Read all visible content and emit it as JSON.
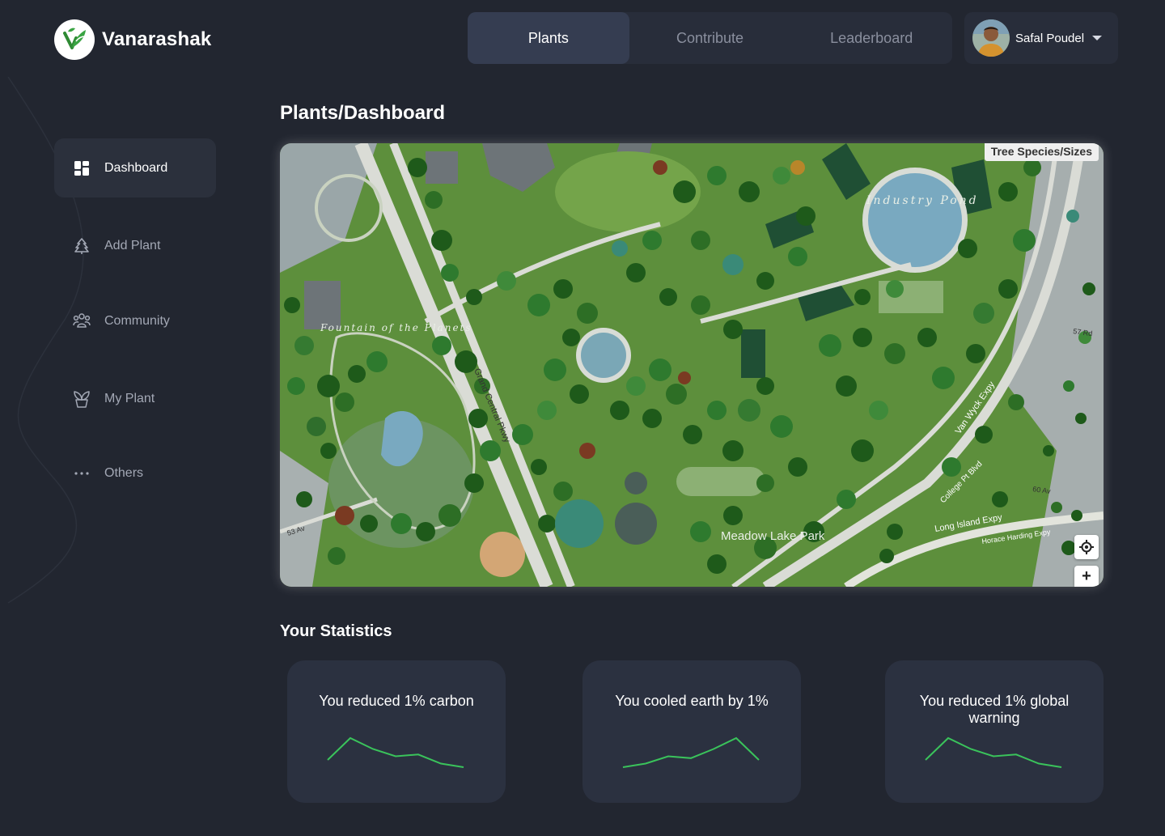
{
  "app": {
    "name": "Vanarashak"
  },
  "topnav": {
    "tabs": [
      {
        "label": "Plants",
        "active": true
      },
      {
        "label": "Contribute",
        "active": false
      },
      {
        "label": "Leaderboard",
        "active": false
      }
    ]
  },
  "user": {
    "name": "Safal Poudel"
  },
  "sidebar": {
    "items": [
      {
        "label": "Dashboard",
        "icon": "dashboard-icon",
        "active": true
      },
      {
        "label": "Add Plant",
        "icon": "tree-icon",
        "active": false
      },
      {
        "label": "Community",
        "icon": "community-icon",
        "active": false
      },
      {
        "label": "My Plant",
        "icon": "potted-plant-icon",
        "active": false
      },
      {
        "label": "Others",
        "icon": "more-icon",
        "active": false
      }
    ]
  },
  "page": {
    "title": "Plants/Dashboard"
  },
  "map": {
    "legend": "Tree Species/Sizes",
    "labels": {
      "pond": "Industry Pond",
      "parkway": "Grand Central Pkwy",
      "vanwyck": "Van Wyck Expy",
      "college": "College Pt Blvd",
      "longisland": "Long Island Expy",
      "horace": "Horace Harding Expy",
      "meadow": "Meadow Lake Park",
      "fountain": "Fountain of the Planets",
      "av53": "53 Av",
      "av60": "60 Av",
      "rd57": "57 Rd"
    },
    "controls": {
      "locate": "locate",
      "zoom_in": "+"
    }
  },
  "stats": {
    "title": "Your Statistics",
    "cards": [
      {
        "text": "You reduced 1% carbon",
        "trend": [
          4,
          10,
          7,
          5,
          5.5,
          3,
          2
        ]
      },
      {
        "text": "You cooled earth by 1%",
        "trend": [
          2,
          3,
          5,
          4.5,
          7,
          10,
          4
        ]
      },
      {
        "text": "You reduced 1% global warning",
        "trend": [
          4,
          10,
          7,
          5,
          5.5,
          3,
          2
        ]
      }
    ],
    "line_color": "#3ac35b"
  },
  "colors": {
    "background": "#222630",
    "panel": "#282d3a",
    "active": "#353d51",
    "accent_green": "#3ac35b"
  }
}
